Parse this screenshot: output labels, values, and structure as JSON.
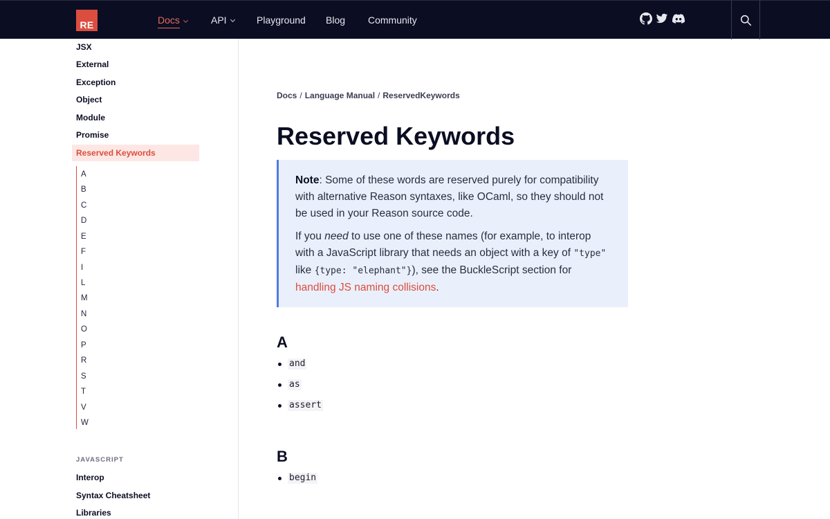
{
  "brand": {
    "logo_text": "RE",
    "accent": "#db4d3f",
    "nav_bg": "#0b0d22"
  },
  "nav": {
    "items": [
      {
        "label": "Docs",
        "has_dropdown": true,
        "active": true
      },
      {
        "label": "API",
        "has_dropdown": true,
        "active": false
      },
      {
        "label": "Playground"
      },
      {
        "label": "Blog"
      },
      {
        "label": "Community"
      }
    ],
    "social_icons": [
      "github-icon",
      "twitter-icon",
      "discord-icon"
    ],
    "search_icon": "search-icon"
  },
  "sidebar": {
    "items": [
      "JSX",
      "External",
      "Exception",
      "Object",
      "Module",
      "Promise"
    ],
    "active_item": "Reserved Keywords",
    "toc": [
      "A",
      "B",
      "C",
      "D",
      "E",
      "F",
      "I",
      "L",
      "M",
      "N",
      "O",
      "P",
      "R",
      "S",
      "T",
      "V",
      "W"
    ],
    "section_label": "JAVASCRIPT",
    "section_items": [
      "Interop",
      "Syntax Cheatsheet",
      "Libraries"
    ]
  },
  "breadcrumb": {
    "items": [
      "Docs",
      "Language Manual",
      "ReservedKeywords"
    ],
    "separator": "/"
  },
  "page": {
    "title": "Reserved Keywords",
    "note": {
      "label": "Note",
      "p1_rest": ": Some of these words are reserved purely for compatibility with alternative Reason syntaxes, like OCaml, so they should not be used in your Reason source code.",
      "p2_a": "If you ",
      "p2_em": "need",
      "p2_b": " to use one of these names (for example, to interop with a JavaScript library that needs an object with a key of ",
      "p2_code1": "\"type\"",
      "p2_c": " like ",
      "p2_code2": "{type: \"elephant\"}",
      "p2_d": "), see the BuckleScript section for ",
      "p2_link": "handling JS naming collisions",
      "p2_end": "."
    },
    "sections": [
      {
        "letter": "A",
        "keywords": [
          "and",
          "as",
          "assert"
        ]
      },
      {
        "letter": "B",
        "keywords": [
          "begin"
        ]
      }
    ]
  }
}
